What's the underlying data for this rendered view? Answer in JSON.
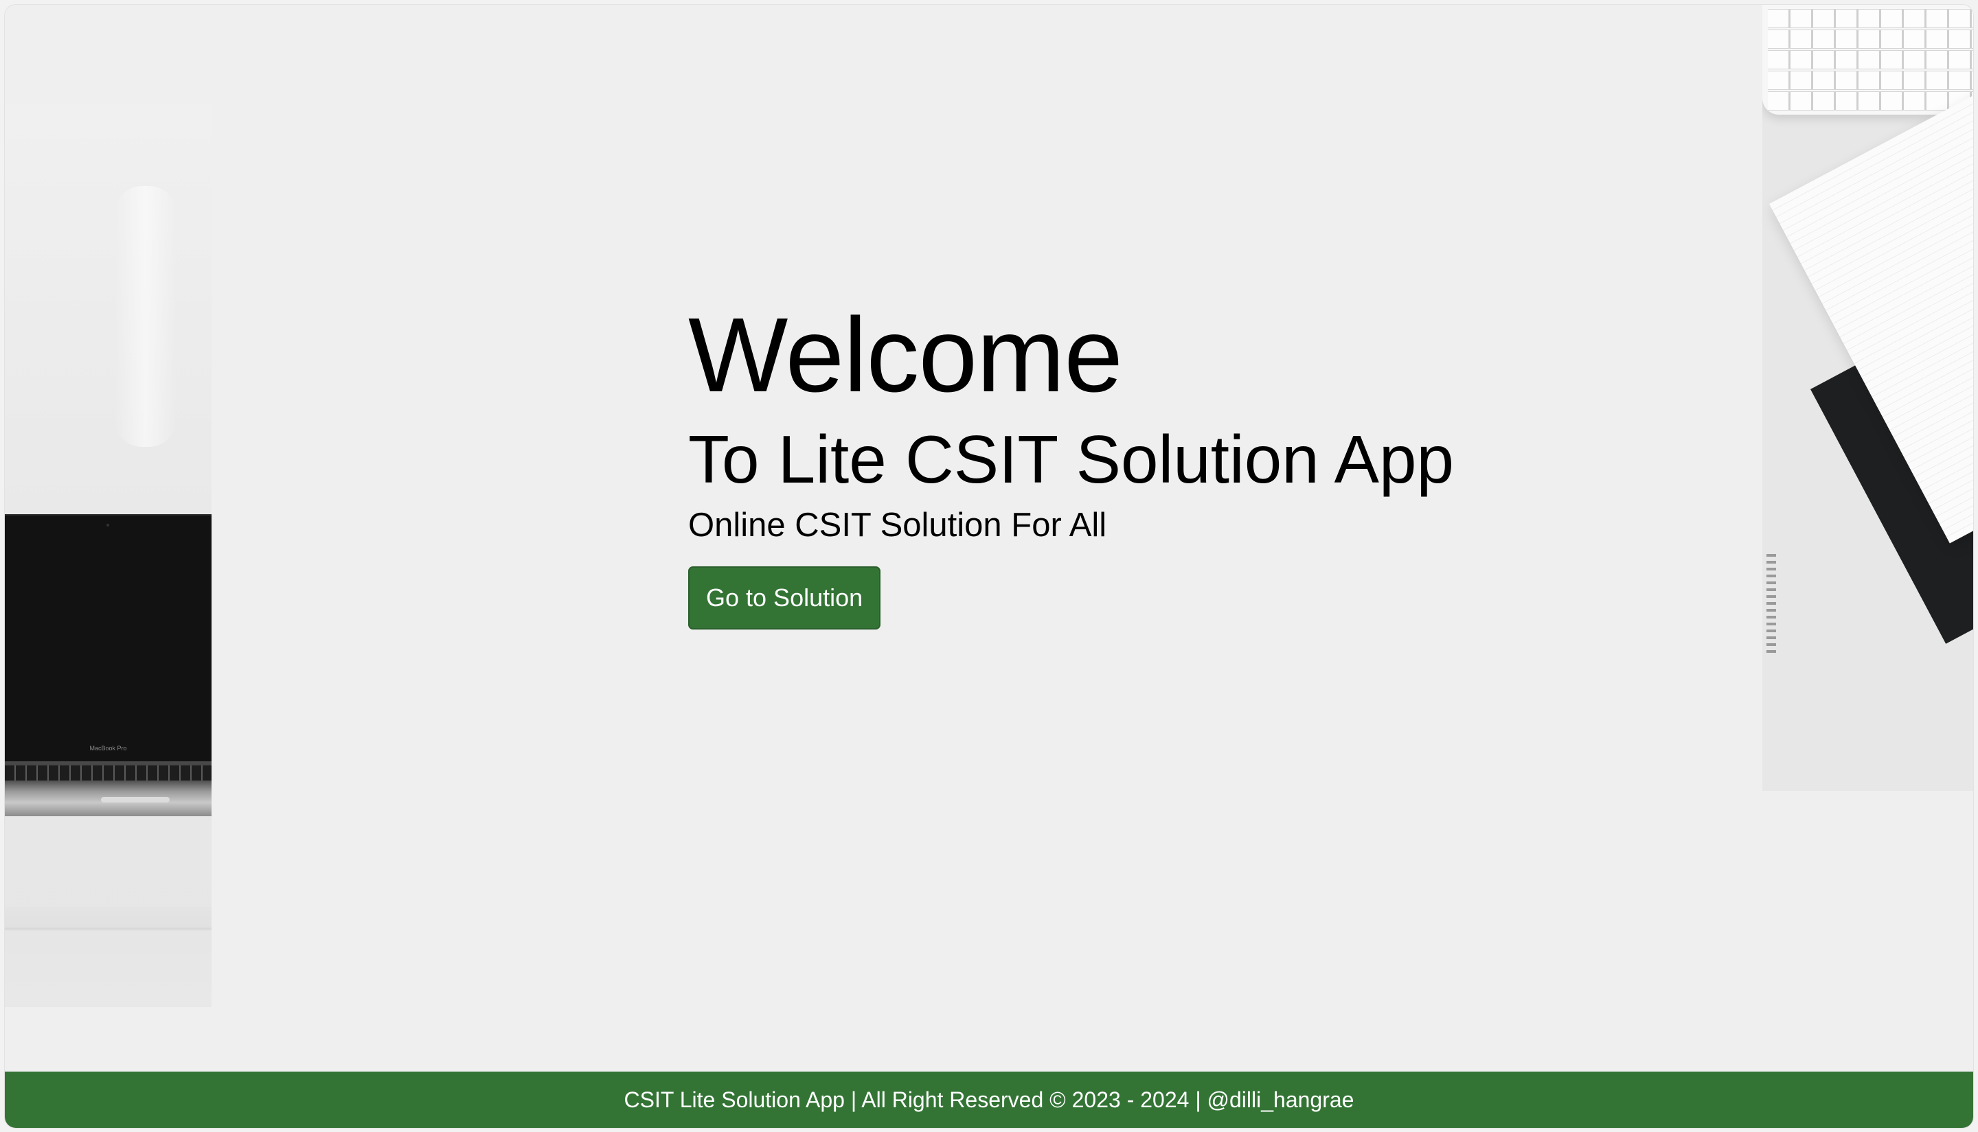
{
  "hero": {
    "title": "Welcome",
    "subtitle": "To Lite CSIT Solution App",
    "tagline": "Online CSIT Solution For All",
    "cta_label": "Go to Solution"
  },
  "left_image": {
    "laptop_brand": "MacBook Pro"
  },
  "footer": {
    "text": "CSIT Lite Solution App | All Right Reserved © 2023 - 2024 | @dilli_hangrae"
  },
  "colors": {
    "brand_green": "#337435",
    "page_background": "#efefef",
    "text": "#000000"
  }
}
